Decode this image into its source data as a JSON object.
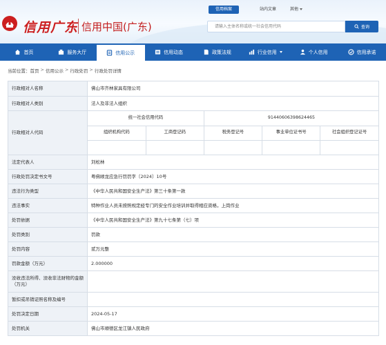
{
  "header": {
    "logo_script": "信用广东",
    "logo_title": "信用中国(广东)",
    "top_links": [
      "信用档案",
      "站内文章",
      "其他"
    ],
    "search": {
      "placeholder": "请输入主体名称或统一社会信用代码",
      "button": "查询"
    }
  },
  "nav": {
    "items": [
      {
        "label": "首页",
        "icon": "home-icon"
      },
      {
        "label": "服务大厅",
        "icon": "service-hall-icon"
      },
      {
        "label": "信用公示",
        "icon": "publicity-icon"
      },
      {
        "label": "信用动态",
        "icon": "news-icon"
      },
      {
        "label": "政策法规",
        "icon": "policy-icon"
      },
      {
        "label": "行业信用",
        "icon": "industry-icon"
      },
      {
        "label": "个人信用",
        "icon": "person-icon"
      },
      {
        "label": "信用承诺",
        "icon": "commitment-icon"
      }
    ],
    "active_index": 2
  },
  "breadcrumb": {
    "prefix": "当前位置：",
    "items": [
      "首页",
      "信用公示",
      "行政处罚",
      "行政处罚详情"
    ]
  },
  "detail": {
    "party_name": {
      "label": "行政相对人名称",
      "value": "佛山市齐林家具有限公司"
    },
    "party_type": {
      "label": "行政相对人类别",
      "value": "法人及非法人组织"
    },
    "party_code": {
      "label": "行政相对人代码",
      "uscc_label": "统一社会信用代码",
      "uscc_value": "91440606398624465",
      "sub_labels": [
        "组织机构代码",
        "工商登记码",
        "税务登记号",
        "事业单位证书号",
        "社会组织登记证号"
      ],
      "sub_values": [
        "",
        "",
        "",
        "",
        ""
      ]
    },
    "rows": [
      {
        "label": "法定代表人",
        "value": "刘松林"
      },
      {
        "label": "行政处罚决定书文号",
        "value": "粤佛顺龙应急行罚罚字〔2024〕10号"
      },
      {
        "label": "违法行为类型",
        "value": "《中华人民共和国安全生产法》第三十条第一款"
      },
      {
        "label": "违法事实",
        "value": "特种作业人员未按照规定经专门的安全作业培训并取得相应资格，上岗作业"
      },
      {
        "label": "处罚依据",
        "value": "《中华人民共和国安全生产法》第九十七条第（七）项"
      },
      {
        "label": "处罚类别",
        "value": "罚款"
      },
      {
        "label": "处罚内容",
        "value": "贰万元整"
      },
      {
        "label": "罚款金额（万元）",
        "value": "2.000000"
      },
      {
        "label": "没收违法所得、没收非法财物的金额（万元）",
        "value": ""
      },
      {
        "label": "暂扣或吊销证照名称及编号",
        "value": ""
      },
      {
        "label": "处罚决定日期",
        "value": "2024-05-17"
      },
      {
        "label": "处罚机关",
        "value": "佛山市顺德区龙江镇人民政府"
      }
    ]
  },
  "colors": {
    "brand_blue": "#1e63b5",
    "logo_red": "#cc1f1f",
    "label_bg": "#eef2f7",
    "border": "#d6dde6"
  }
}
